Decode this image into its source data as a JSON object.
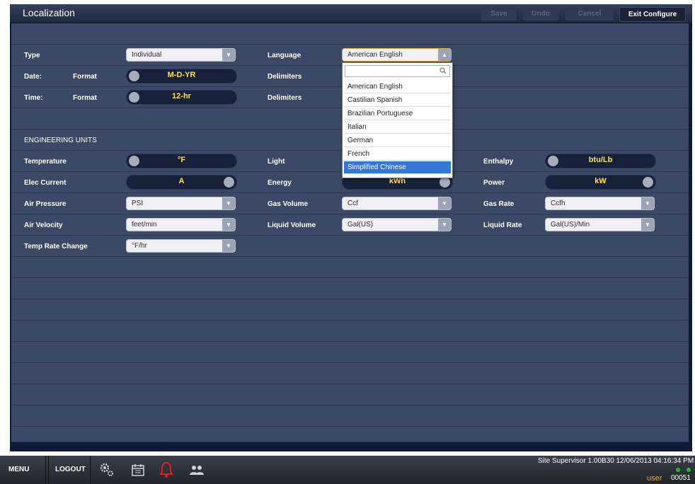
{
  "header": {
    "title": "Localization",
    "save": "Save",
    "undo": "Undo",
    "cancel": "Cancel",
    "exit": "Exit Configure"
  },
  "rows": {
    "type_label": "Type",
    "type_value": "Individual",
    "language_label": "Language",
    "language_value": "American English",
    "date_label": "Date:",
    "date_format_label": "Format",
    "date_format_value": "M-D-YR",
    "date_delim_label": "Delimiters",
    "time_label": "Time:",
    "time_format_label": "Format",
    "time_format_value": "12-hr",
    "time_delim_label": "Delimiters",
    "section_label": "ENGINEERING UNITS",
    "temperature_label": "Temperature",
    "temperature_value": "°F",
    "light_label": "Light",
    "enthalpy_label": "Enthalpy",
    "enthalpy_value": "btu/Lb",
    "elec_current_label": "Elec Current",
    "elec_current_value": "A",
    "energy_label": "Energy",
    "energy_value": "kWh",
    "power_label": "Power",
    "power_value": "kW",
    "air_pressure_label": "Air Pressure",
    "air_pressure_value": "PSI",
    "gas_volume_label": "Gas Volume",
    "gas_volume_value": "Ccf",
    "gas_rate_label": "Gas Rate",
    "gas_rate_value": "Ccfh",
    "air_velocity_label": "Air Velocity",
    "air_velocity_value": "feet/min",
    "liquid_volume_label": "Liquid Volume",
    "liquid_volume_value": "Gal(US)",
    "liquid_rate_label": "Liquid Rate",
    "liquid_rate_value": "Gal(US)/Min",
    "temp_rate_label": "Temp Rate Change",
    "temp_rate_value": "°F/hr"
  },
  "dropdown": {
    "items": [
      "American English",
      "Castilian Spanish",
      "Brazilian Portuguese",
      "Italian",
      "German",
      "French",
      "Simplified Chinese"
    ],
    "selected": "Simplified Chinese"
  },
  "footer": {
    "menu": "MENU",
    "logout": "LOGOUT",
    "status": "Site Supervisor 1.00B30 12/06/2013 04:16:34 PM",
    "user": "user",
    "code": "00051"
  },
  "icons": [
    "gear-icon",
    "calendar-icon",
    "alarm-bell-icon",
    "users-icon",
    "search-icon"
  ],
  "colors": {
    "toggle_text": "#ffe34b",
    "selected": "#3477d6",
    "alarm": "#e02020"
  }
}
